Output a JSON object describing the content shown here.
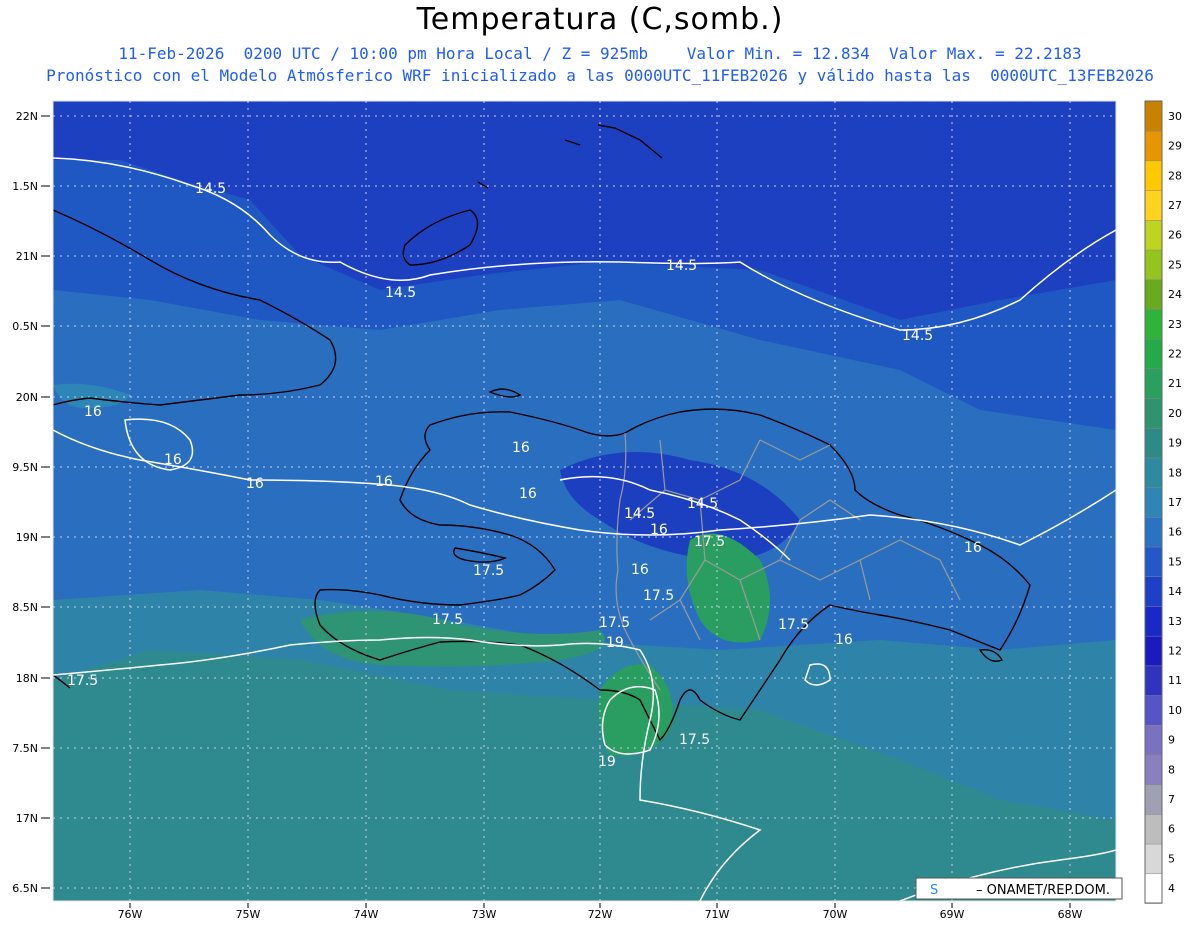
{
  "title": "Temperatura (C,somb.)",
  "subtitle1": "11-Feb-2026  0200 UTC / 10:00 pm Hora Local / Z = 925mb    Valor Min. = 12.834  Valor Max. = 22.2183",
  "subtitle2": "Pronóstico con el Modelo Atmósferico WRF inicializado a las 0000UTC_11FEB2026 y válido hasta las  0000UTC_13FEB2026",
  "credit": "– ONAMET/REP.DOM.",
  "credit_prefix": "S",
  "lat_labels": [
    "22N",
    "1.5N",
    "21N",
    "0.5N",
    "20N",
    "9.5N",
    "19N",
    "8.5N",
    "18N",
    "7.5N",
    "17N",
    "6.5N"
  ],
  "lon_labels": [
    "76W",
    "75W",
    "74W",
    "73W",
    "72W",
    "71W",
    "70W",
    "69W",
    "68W"
  ],
  "contour_labels": [
    "14.5",
    "14.5",
    "14.5",
    "14.5",
    "14.5",
    "14.5",
    "16",
    "16",
    "16",
    "16",
    "16",
    "16",
    "16",
    "16",
    "16",
    "16",
    "17.5",
    "17.5",
    "17.5",
    "17.5",
    "17.5",
    "17.5",
    "17.5",
    "17.5",
    "19",
    "19"
  ],
  "colorbar": {
    "levels": [
      "4",
      "5",
      "6",
      "7",
      "8",
      "9",
      "10",
      "11",
      "12",
      "13",
      "14",
      "15",
      "16",
      "17",
      "18",
      "19",
      "20",
      "21",
      "22",
      "23",
      "24",
      "25",
      "26",
      "27",
      "28",
      "29",
      "30"
    ],
    "colors": [
      "#ffffff",
      "#d8d8d8",
      "#bdbdbd",
      "#a0a0b4",
      "#8a7fbf",
      "#7a72c0",
      "#5555c8",
      "#3232c0",
      "#1a1ac0",
      "#1a28c8",
      "#1e40c8",
      "#2458c8",
      "#2a72c2",
      "#2e86b6",
      "#2e8aa0",
      "#2e8a86",
      "#2e9470",
      "#2aa05e",
      "#24aa48",
      "#2eb438",
      "#6aaa1e",
      "#96c41e",
      "#bed41e",
      "#ffd21e",
      "#ffc800",
      "#e69600",
      "#c88200"
    ]
  }
}
